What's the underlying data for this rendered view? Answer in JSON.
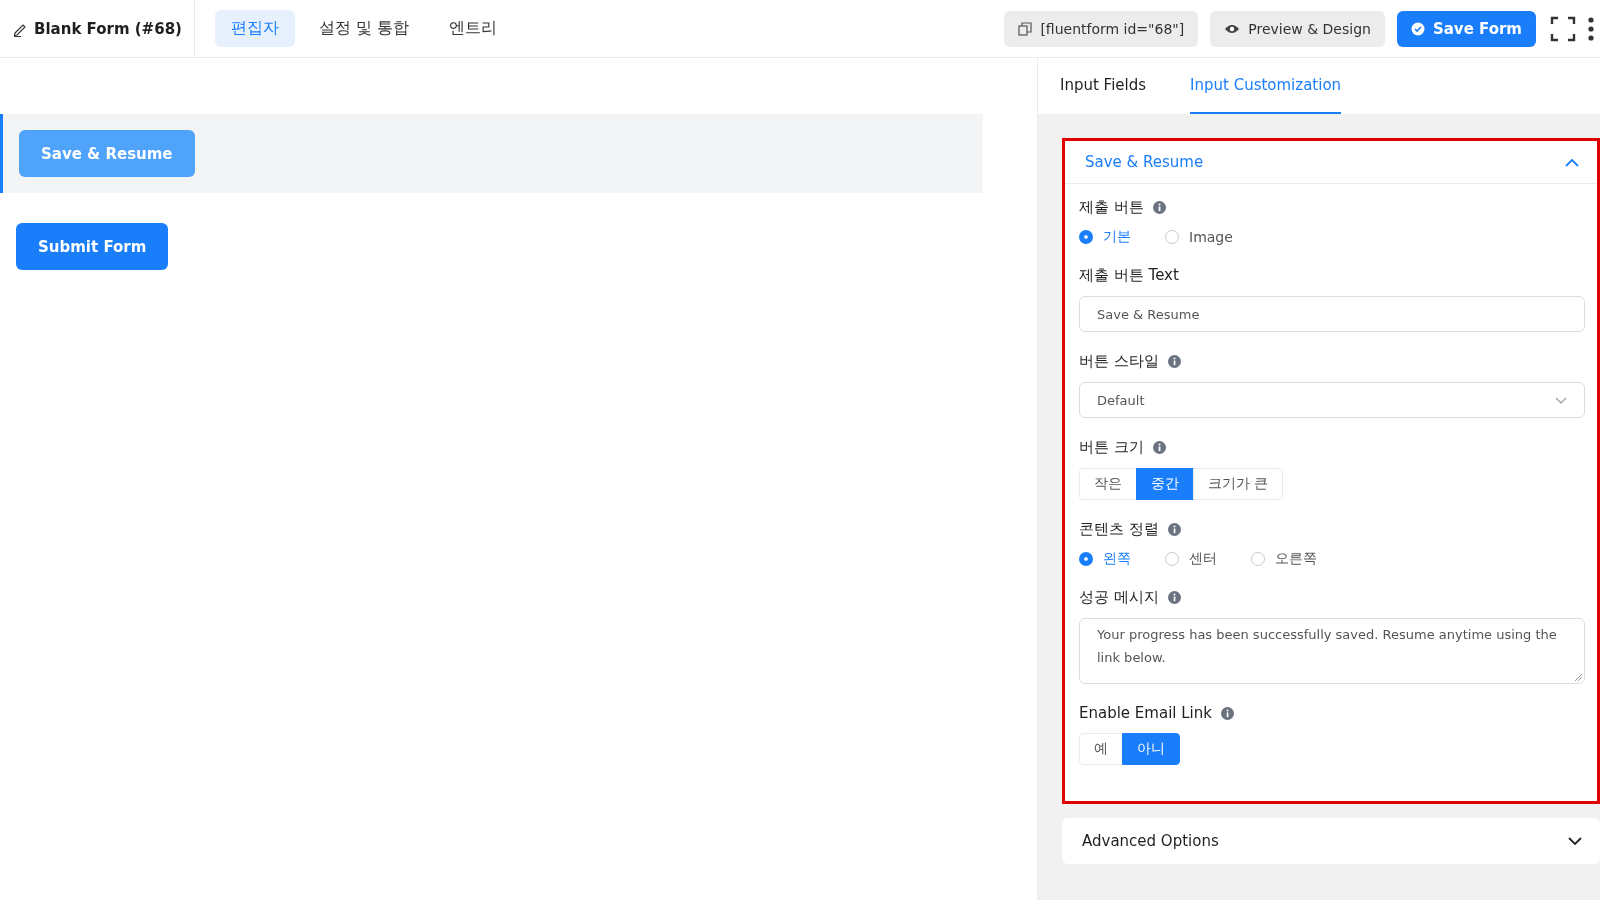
{
  "header": {
    "form_title": "Blank Form (#68)",
    "tabs": [
      {
        "label": "편집자",
        "selected": true
      },
      {
        "label": "설정 및 통합",
        "selected": false
      },
      {
        "label": "엔트리",
        "selected": false
      }
    ],
    "shortcode": "[fluentform id=\"68\"]",
    "preview_button": "Preview & Design",
    "save_button": "Save Form"
  },
  "canvas": {
    "fields": [
      {
        "label": "Save & Resume",
        "selected": true
      },
      {
        "label": "Submit Form",
        "selected": false
      }
    ]
  },
  "sidebar": {
    "tabs": [
      {
        "label": "Input Fields",
        "selected": false
      },
      {
        "label": "Input Customization",
        "selected": true
      }
    ],
    "sections": [
      {
        "title": "Save & Resume",
        "expanded": true,
        "highlighted": true,
        "settings": [
          {
            "kind": "radio",
            "label": "제출 버튼",
            "info": true,
            "options": [
              {
                "label": "기본",
                "selected": true
              },
              {
                "label": "Image",
                "selected": false
              }
            ]
          },
          {
            "kind": "text",
            "label": "제출 버튼 Text",
            "info": false,
            "value": "Save & Resume"
          },
          {
            "kind": "select",
            "label": "버튼 스타일",
            "info": true,
            "value": "Default"
          },
          {
            "kind": "segmented",
            "label": "버튼 크기",
            "info": true,
            "options": [
              {
                "label": "작은",
                "selected": false
              },
              {
                "label": "중간",
                "selected": true
              },
              {
                "label": "크기가 큰",
                "selected": false
              }
            ]
          },
          {
            "kind": "radio",
            "label": "콘텐츠 정렬",
            "info": true,
            "options": [
              {
                "label": "왼쪽",
                "selected": true
              },
              {
                "label": "센터",
                "selected": false
              },
              {
                "label": "오른쪽",
                "selected": false
              }
            ]
          },
          {
            "kind": "textarea",
            "label": "성공 메시지",
            "info": true,
            "value": "Your progress has been successfully saved. Resume anytime using the link below."
          },
          {
            "kind": "segmented",
            "label": "Enable Email Link",
            "info": true,
            "options": [
              {
                "label": "예",
                "selected": false
              },
              {
                "label": "아니",
                "selected": true
              }
            ]
          }
        ]
      },
      {
        "title": "Advanced Options",
        "expanded": false,
        "highlighted": false
      }
    ]
  }
}
